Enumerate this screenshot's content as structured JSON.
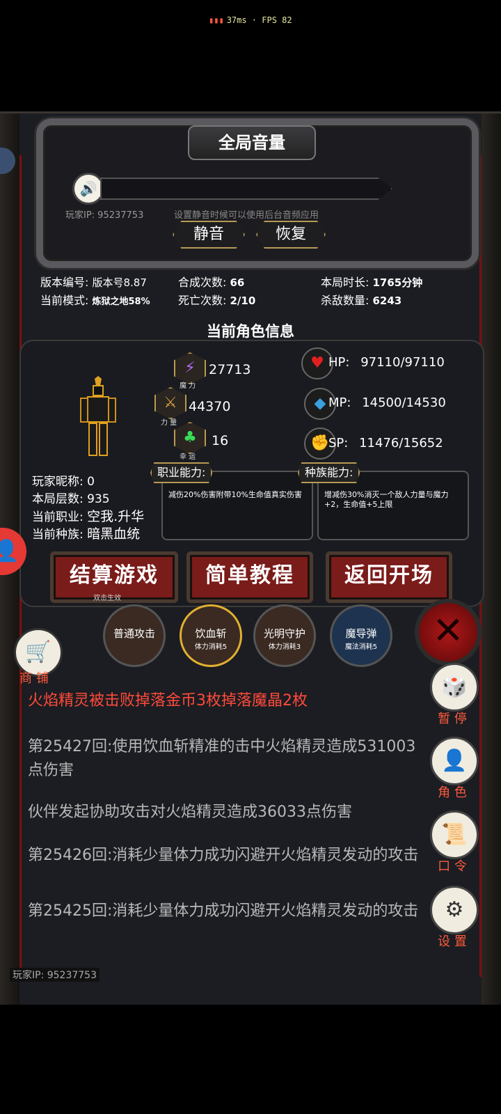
{
  "status": {
    "net": "37ms · FPS 82"
  },
  "volume_panel": {
    "title": "全局音量",
    "player_ip_label": "玩家IP: 95237753",
    "hint": "设置静音时候可以使用后台音频应用",
    "mute_label": "静音",
    "restore_label": "恢复"
  },
  "stats": {
    "version_label": "版本编号:",
    "version_value": "版本号8.87",
    "mode_label": "当前模式:",
    "mode_value": "炼狱之地58%",
    "synth_label": "合成次数:",
    "synth_value": "66",
    "death_label": "死亡次数:",
    "death_value": "2/10",
    "time_label": "本局时长:",
    "time_value": "1765分钟",
    "kill_label": "杀敌数量:",
    "kill_value": "6243"
  },
  "role": {
    "title": "当前角色信息",
    "magic_value": "27713",
    "magic_label": "魔 力",
    "strength_value": "44370",
    "strength_label": "力 量",
    "luck_value": "16",
    "luck_label": "幸 运",
    "hp_label": "HP:",
    "hp_value": "97110/97110",
    "mp_label": "MP:",
    "mp_value": "14500/14530",
    "sp_label": "SP:",
    "sp_value": "11476/15652",
    "nickname_label": "玩家昵称:",
    "nickname_value": "0",
    "floor_label": "本局层数:",
    "floor_value": "935",
    "job_label": "当前职业:",
    "job_value": "空我.升华",
    "race_label": "当前种族:",
    "race_value": "暗黑血统",
    "job_ability_title": "职业能力:",
    "job_ability_text": "减伤20%伤害附带10%生命值真实伤害",
    "race_ability_title": "种族能力:",
    "race_ability_text": "增减伤30%消灭一个敌人力量与魔力+2，生命值+5上限"
  },
  "buttons": {
    "settle": "结算游戏",
    "tutorial": "简单教程",
    "back": "返回开场",
    "double_click_hint": "双击生效"
  },
  "skills": [
    {
      "name": "普通攻击",
      "cost": ""
    },
    {
      "name": "饮血斩",
      "cost": "体力消耗5"
    },
    {
      "name": "光明守护",
      "cost": "体力消耗3"
    },
    {
      "name": "魔导弹",
      "cost": "魔法消耗5"
    }
  ],
  "shop_label": "商 铺",
  "log": [
    {
      "text": "火焰精灵被击败掉落金币3枚掉落魔晶2枚",
      "color": "#ff4a3a"
    },
    {
      "text": "第25427回:使用饮血斩精准的击中火焰精灵造成531003点伤害",
      "color": "#b8b8b8"
    },
    {
      "text": "伙伴发起协助攻击对火焰精灵造成36033点伤害",
      "color": "#b8b8b8"
    },
    {
      "text": "第25426回:消耗少量体力成功闪避开火焰精灵发动的攻击",
      "color": "#b8b8b8"
    },
    {
      "text": "第25425回:消耗少量体力成功闪避开火焰精灵发动的攻击",
      "color": "#b8b8b8"
    }
  ],
  "side": {
    "pause": "暂 停",
    "role": "角 色",
    "code": "口 令",
    "settings": "设 置"
  },
  "footer_ip": "玩家IP: 95237753"
}
